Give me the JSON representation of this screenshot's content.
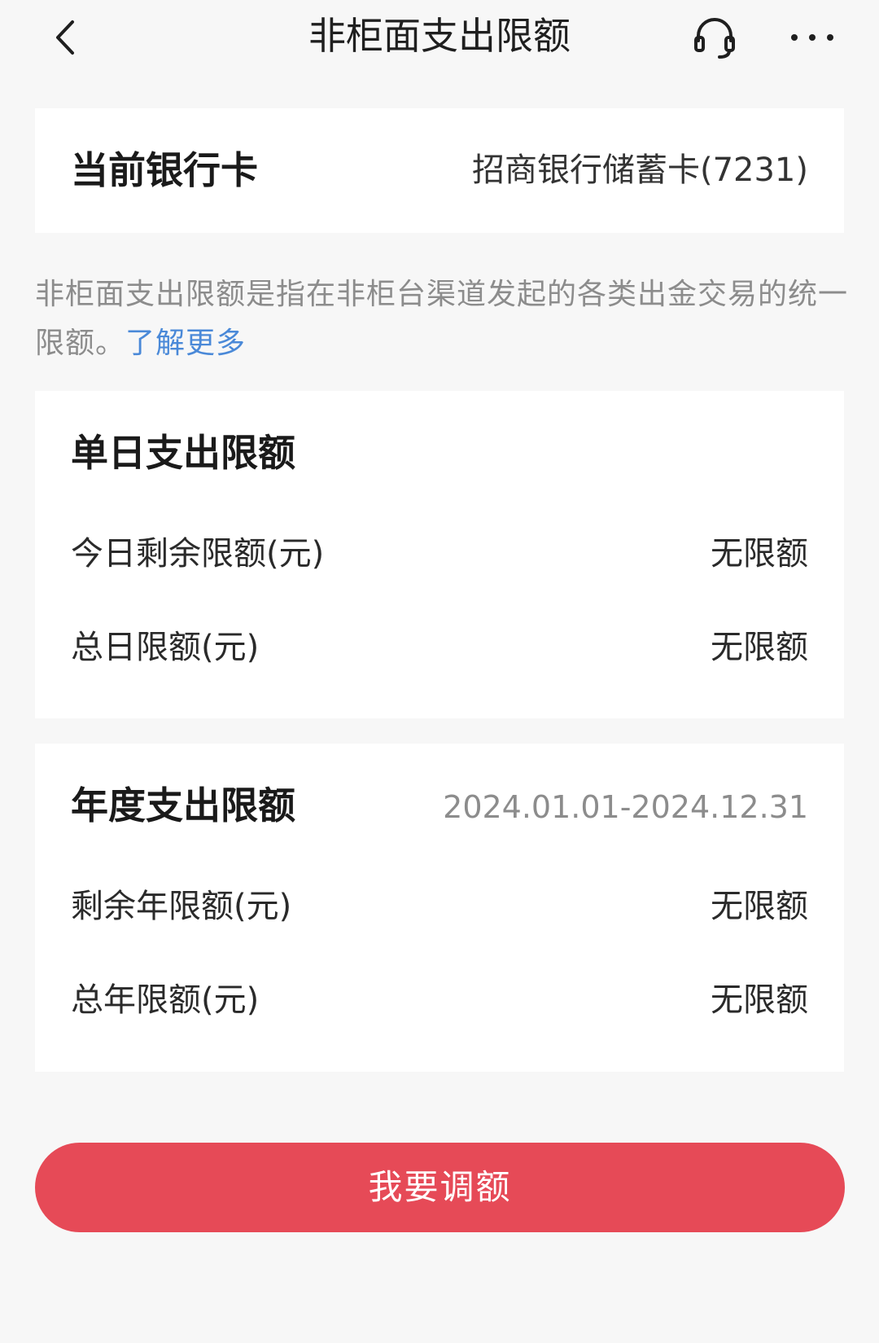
{
  "nav": {
    "title": "非柜面支出限额",
    "back_icon": "chevron-left-icon",
    "support_icon": "headset-icon",
    "more_icon": "more-dots-icon"
  },
  "bank_card": {
    "label": "当前银行卡",
    "value": "招商银行储蓄卡(7231)"
  },
  "description": {
    "text": "非柜面支出限额是指在非柜台渠道发起的各类出金交易的统一限额。",
    "link": "了解更多"
  },
  "daily_limit": {
    "heading": "单日支出限额",
    "rows": [
      {
        "label": "今日剩余限额(元)",
        "value": "无限额"
      },
      {
        "label": "总日限额(元)",
        "value": "无限额"
      }
    ]
  },
  "annual_limit": {
    "heading": "年度支出限额",
    "period": "2024.01.01-2024.12.31",
    "rows": [
      {
        "label": "剩余年限额(元)",
        "value": "无限额"
      },
      {
        "label": "总年限额(元)",
        "value": "无限额"
      }
    ]
  },
  "adjust_button": {
    "label": "我要调额"
  },
  "colors": {
    "accent": "#e64a57",
    "link": "#4a89d8",
    "background": "#f7f7f7"
  }
}
